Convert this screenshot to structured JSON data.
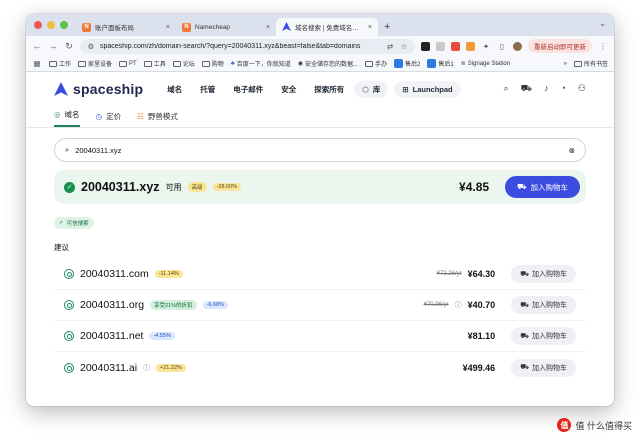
{
  "browser": {
    "tabs": [
      {
        "title": "账户面板布局",
        "icon_color": "#f0793a",
        "active": false
      },
      {
        "title": "Namecheap",
        "icon_color": "#f0793a",
        "active": false
      },
      {
        "title": "域名搜索 | 免费域名可用性工具",
        "icon_color": "#3c4ce0",
        "active": true
      }
    ],
    "url": "spaceship.com/zh/domain-search/?query=20040311.xyz&beast=false&tab=domains",
    "update_label": "重新启动即可更新",
    "bookmarks": [
      "工作",
      "家里设备",
      "PT",
      "工具",
      "论坛",
      "购物",
      "百度一下，你就知道",
      "安全储存您的数据...",
      "手办",
      "售后2",
      "售后1",
      "Signage Station"
    ],
    "all_bookmarks": "所有书签"
  },
  "site": {
    "brand": "spaceship",
    "brand_color": "#3c4ce0",
    "nav": [
      "域名",
      "托管",
      "电子邮件",
      "安全",
      "探索所有"
    ],
    "library_label": "库",
    "launchpad_label": "Launchpad"
  },
  "subtabs": [
    {
      "label": "域名",
      "active": true
    },
    {
      "label": "定价",
      "active": false
    },
    {
      "label": "野兽模式",
      "active": false
    }
  ],
  "search": {
    "value": "20040311.xyz"
  },
  "main_result": {
    "domain": "20040311.xyz",
    "status": "可用",
    "tag": "高级",
    "discount": "-28.00%",
    "price": "¥4.85",
    "cart_label": "加入购物车"
  },
  "trusted_label": "可信搜索",
  "suggestions_title": "建议",
  "suggestions": [
    {
      "domain": "20040311.com",
      "badge": "-11.14%",
      "badge_type": "yellow",
      "extra_badge": "",
      "old_price": "¥72.26/yr",
      "price": "¥64.30",
      "cart_label": "加入购物车"
    },
    {
      "domain": "20040311.org",
      "badge": "-6.68%",
      "badge_type": "blue",
      "extra_badge": "享受21%的折扣",
      "old_price": "¥70.96/yr",
      "price": "¥40.70",
      "cart_label": "加入购物车"
    },
    {
      "domain": "20040311.net",
      "badge": "-4.55%",
      "badge_type": "blue",
      "extra_badge": "",
      "old_price": "",
      "price": "¥81.10",
      "cart_label": "加入购物车"
    },
    {
      "domain": "20040311.ai",
      "badge": "+21.22%",
      "badge_type": "yellow",
      "extra_badge": "",
      "old_price": "",
      "price": "¥499.46",
      "cart_label": "加入购物车"
    }
  ],
  "watermark": "值 什么值得买"
}
